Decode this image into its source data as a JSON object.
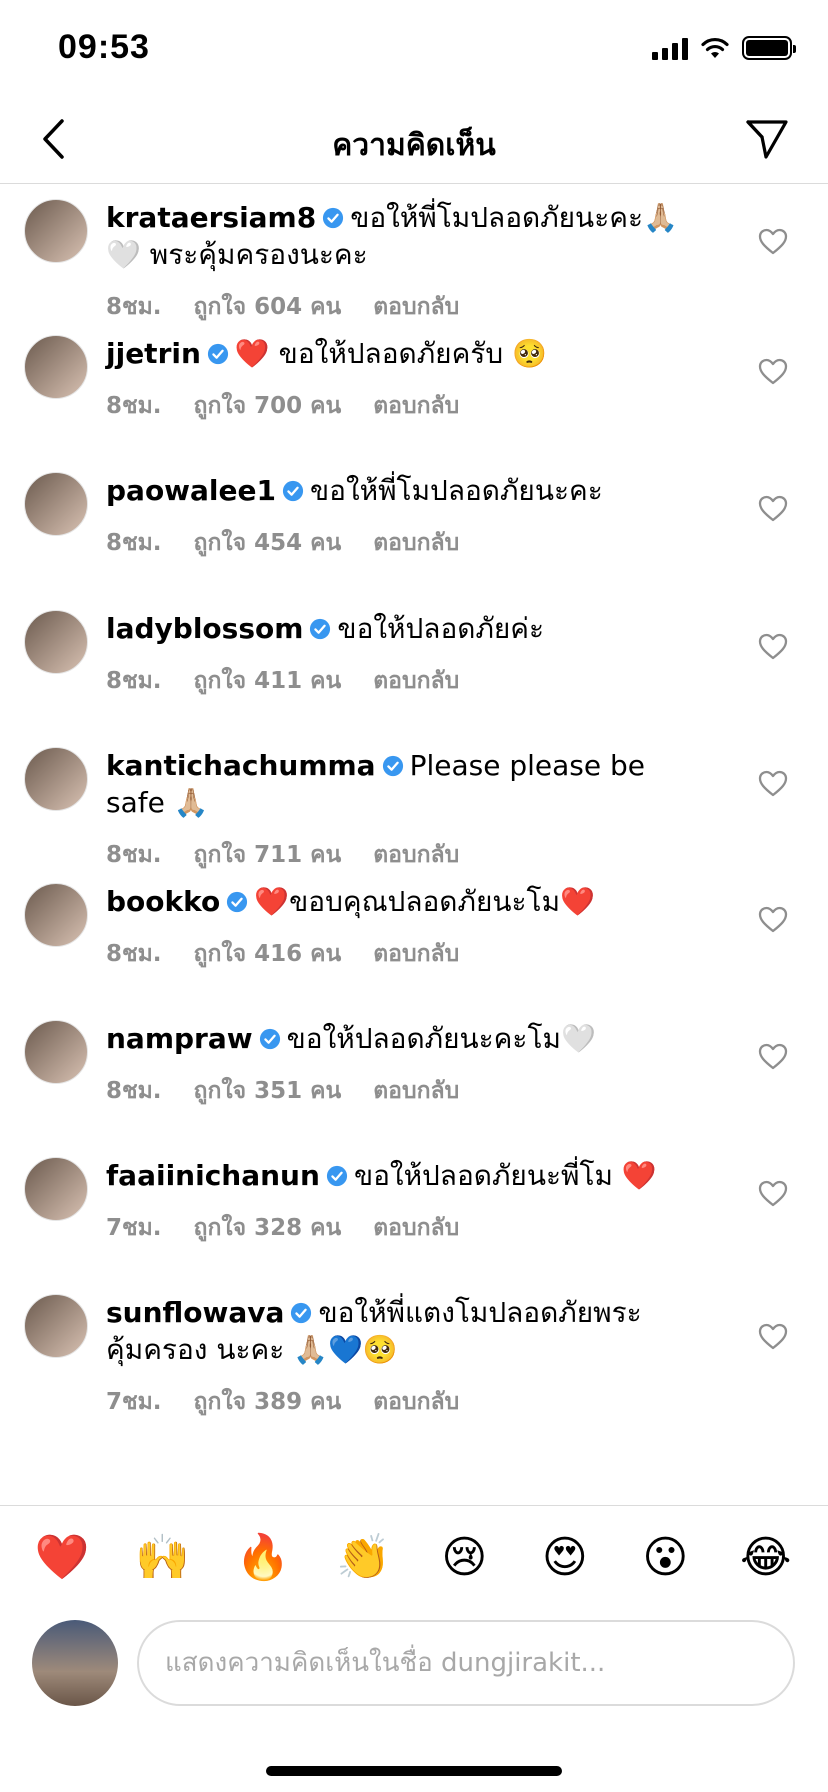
{
  "status_bar": {
    "time": "09:53"
  },
  "header": {
    "title": "ความคิดเห็น"
  },
  "comments": [
    {
      "username": "krataersiam8",
      "text": "ขอให้พี่โมปลอดภัยนะคะ🙏🏼🤍 พระคุ้มครองนะคะ",
      "time": "8ชม.",
      "likes": "ถูกใจ 604 คน",
      "reply": "ตอบกลับ"
    },
    {
      "username": "jjetrin",
      "text": "❤️ ขอให้ปลอดภัยครับ 🥺",
      "time": "8ชม.",
      "likes": "ถูกใจ 700 คน",
      "reply": "ตอบกลับ"
    },
    {
      "username": "paowalee1",
      "text": "ขอให้พี่โมปลอดภัยนะคะ",
      "time": "8ชม.",
      "likes": "ถูกใจ 454 คน",
      "reply": "ตอบกลับ"
    },
    {
      "username": "ladyblossom",
      "text": "ขอให้ปลอดภัยค่ะ",
      "time": "8ชม.",
      "likes": "ถูกใจ 411 คน",
      "reply": "ตอบกลับ"
    },
    {
      "username": "kantichachumma",
      "text": "Please please be safe 🙏🏼",
      "time": "8ชม.",
      "likes": "ถูกใจ 711 คน",
      "reply": "ตอบกลับ"
    },
    {
      "username": "bookko",
      "text": "❤️ขอบคุณปลอดภัยนะโม❤️",
      "time": "8ชม.",
      "likes": "ถูกใจ 416 คน",
      "reply": "ตอบกลับ"
    },
    {
      "username": "nampraw",
      "text": "ขอให้ปลอดภัยนะคะโม🤍",
      "time": "8ชม.",
      "likes": "ถูกใจ 351 คน",
      "reply": "ตอบกลับ"
    },
    {
      "username": "faaiinichanun",
      "text": "ขอให้ปลอดภัยนะพี่โม ❤️",
      "time": "7ชม.",
      "likes": "ถูกใจ 328 คน",
      "reply": "ตอบกลับ"
    },
    {
      "username": "sunflowava",
      "text": "ขอให้พี่แตงโมปลอดภัยพระคุ้มครอง นะคะ 🙏🏼💙🥺",
      "time": "7ชม.",
      "likes": "ถูกใจ 389 คน",
      "reply": "ตอบกลับ"
    }
  ],
  "emoji_bar": [
    "❤️",
    "🙌",
    "🔥",
    "👏",
    "😢",
    "😍",
    "😮",
    "😂"
  ],
  "input": {
    "placeholder": "แสดงความคิดเห็นในชื่อ dungjirakit..."
  },
  "colors": {
    "verified": "#3897f0",
    "meta": "#8e8e8e",
    "divider": "#dbdbdb"
  }
}
